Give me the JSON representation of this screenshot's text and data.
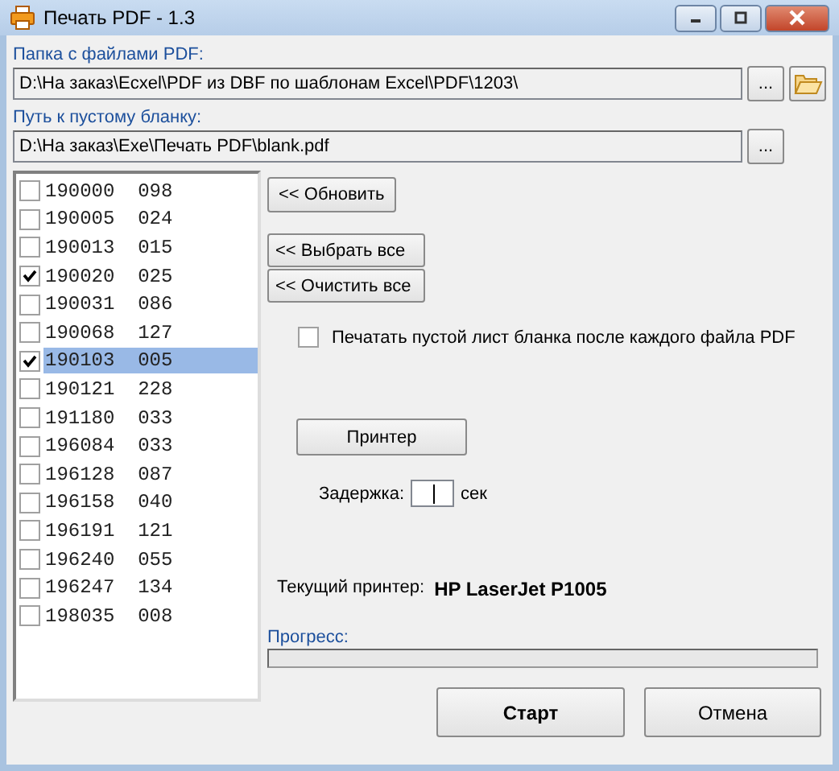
{
  "window": {
    "title": "Печать PDF - 1.3"
  },
  "folder": {
    "label": "Папка с файлами PDF:",
    "value": "D:\\На заказ\\Ecxel\\PDF из DBF по шаблонам Excel\\PDF\\1203\\",
    "browse": "..."
  },
  "blank": {
    "label": "Путь к пустому бланку:",
    "value": "D:\\На заказ\\Exe\\Печать PDF\\blank.pdf",
    "browse": "..."
  },
  "files": [
    {
      "name": "190000  098",
      "checked": false,
      "selected": false
    },
    {
      "name": "190005  024",
      "checked": false,
      "selected": false
    },
    {
      "name": "190013  015",
      "checked": false,
      "selected": false
    },
    {
      "name": "190020  025",
      "checked": true,
      "selected": false
    },
    {
      "name": "190031  086",
      "checked": false,
      "selected": false
    },
    {
      "name": "190068  127",
      "checked": false,
      "selected": false
    },
    {
      "name": "190103  005",
      "checked": true,
      "selected": true
    },
    {
      "name": "190121  228",
      "checked": false,
      "selected": false
    },
    {
      "name": "191180  033",
      "checked": false,
      "selected": false
    },
    {
      "name": "196084  033",
      "checked": false,
      "selected": false
    },
    {
      "name": "196128  087",
      "checked": false,
      "selected": false
    },
    {
      "name": "196158  040",
      "checked": false,
      "selected": false
    },
    {
      "name": "196191  121",
      "checked": false,
      "selected": false
    },
    {
      "name": "196240  055",
      "checked": false,
      "selected": false
    },
    {
      "name": "196247  134",
      "checked": false,
      "selected": false
    },
    {
      "name": "198035  008",
      "checked": false,
      "selected": false
    }
  ],
  "refresh_button": "<< Обновить",
  "select_all_button": "<< Выбрать все",
  "clear_all_button": "<< Очистить все",
  "print_blank": {
    "label": "Печатать пустой лист бланка после каждого файла PDF",
    "checked": false
  },
  "printer_button": "Принтер",
  "delay": {
    "label": "Задержка:",
    "unit": "сек"
  },
  "current_printer": {
    "label": "Текущий принтер:",
    "value": "HP LaserJet P1005"
  },
  "progress": {
    "label": "Прогресс:",
    "level": 0
  },
  "buttons": [
    {
      "label": "Старт",
      "kind": "default"
    },
    {
      "label": "Отмена",
      "kind": "normal"
    }
  ]
}
